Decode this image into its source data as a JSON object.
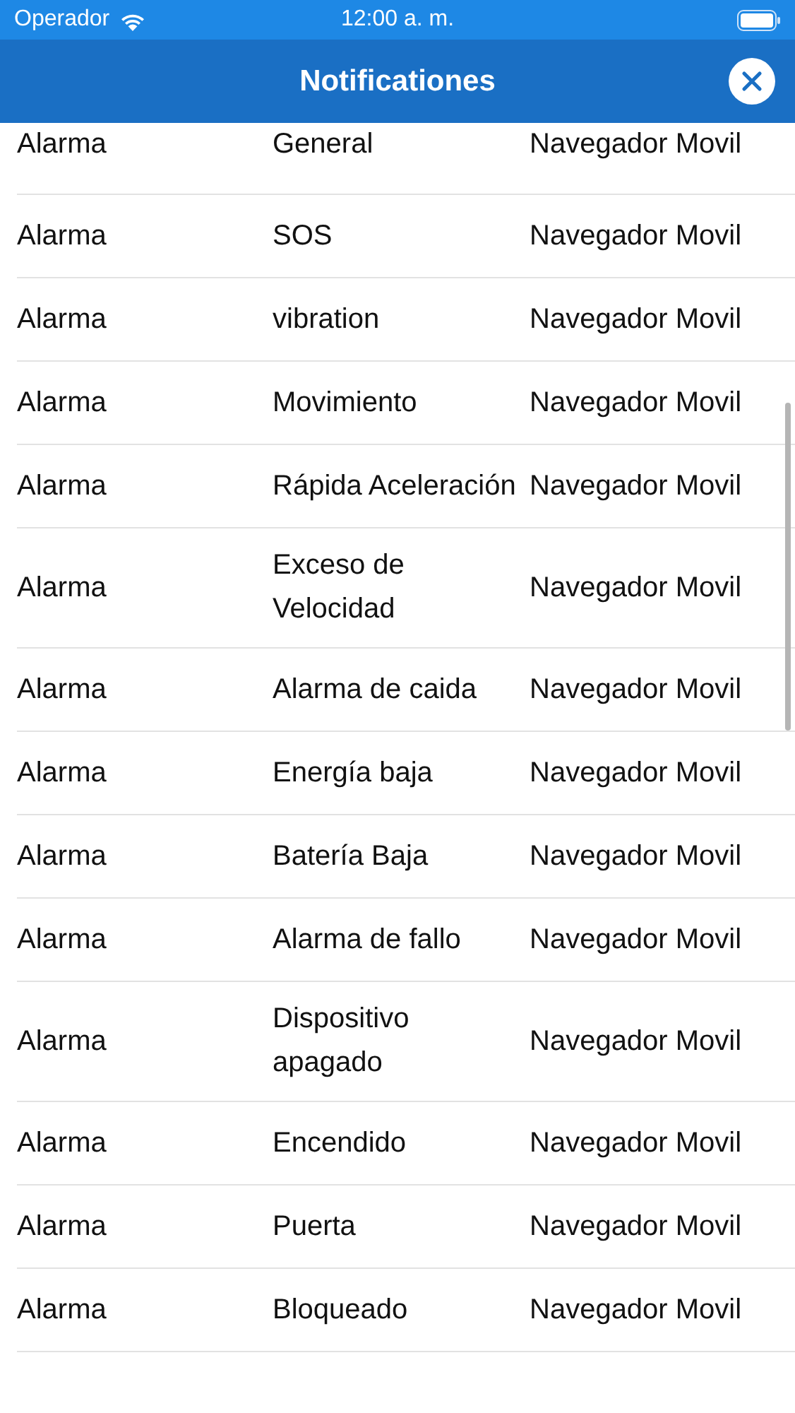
{
  "status_bar": {
    "carrier": "Operador",
    "time": "12:00 a. m."
  },
  "nav_bar": {
    "title": "Notificationes"
  },
  "rows": [
    {
      "column_1": "Alarma",
      "column_2": "General",
      "column_3": "Navegador Movil"
    },
    {
      "column_1": "Alarma",
      "column_2": "SOS",
      "column_3": "Navegador Movil"
    },
    {
      "column_1": "Alarma",
      "column_2": "vibration",
      "column_3": "Navegador Movil"
    },
    {
      "column_1": "Alarma",
      "column_2": "Movimiento",
      "column_3": "Navegador Movil"
    },
    {
      "column_1": "Alarma",
      "column_2": "Rápida Aceleración",
      "column_3": "Navegador Movil"
    },
    {
      "column_1": "Alarma",
      "column_2": "Exceso de Velocidad",
      "column_3": "Navegador Movil"
    },
    {
      "column_1": "Alarma",
      "column_2": "Alarma de caida",
      "column_3": "Navegador Movil"
    },
    {
      "column_1": "Alarma",
      "column_2": "Energía baja",
      "column_3": "Navegador Movil"
    },
    {
      "column_1": "Alarma",
      "column_2": "Batería Baja",
      "column_3": "Navegador Movil"
    },
    {
      "column_1": "Alarma",
      "column_2": "Alarma de fallo",
      "column_3": "Navegador Movil"
    },
    {
      "column_1": "Alarma",
      "column_2": "Dispositivo apagado",
      "column_3": "Navegador Movil"
    },
    {
      "column_1": "Alarma",
      "column_2": "Encendido",
      "column_3": "Navegador Movil"
    },
    {
      "column_1": "Alarma",
      "column_2": "Puerta",
      "column_3": "Navegador Movil"
    },
    {
      "column_1": "Alarma",
      "column_2": "Bloqueado",
      "column_3": "Navegador Movil"
    }
  ]
}
